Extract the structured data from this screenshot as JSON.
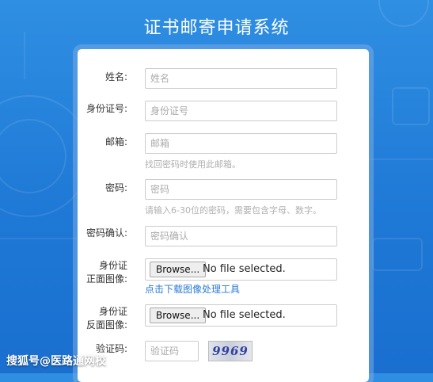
{
  "page": {
    "title": "证书邮寄申请系统"
  },
  "form": {
    "name": {
      "label": "姓名:",
      "placeholder": "姓名"
    },
    "id_number": {
      "label": "身份证号:",
      "placeholder": "身份证号"
    },
    "email": {
      "label": "邮箱:",
      "placeholder": "邮箱",
      "hint": "找回密码时使用此邮箱。"
    },
    "password": {
      "label": "密码:",
      "placeholder": "密码",
      "hint": "请输入6-30位的密码，需要包含字母、数字。"
    },
    "password_confirm": {
      "label": "密码确认:",
      "placeholder": "密码确认"
    },
    "id_front": {
      "label_line1": "身份证",
      "label_line2": "正面图像:",
      "browse_label": "Browse...",
      "status": "No file selected.",
      "tool_link": "点击下载图像处理工具"
    },
    "id_back": {
      "label_line1": "身份证",
      "label_line2": "反面图像:",
      "browse_label": "Browse...",
      "status": "No file selected."
    },
    "captcha": {
      "label": "验证码:",
      "placeholder": "验证码",
      "image_text": "9969"
    }
  },
  "watermark": "搜狐号@医路通网校"
}
